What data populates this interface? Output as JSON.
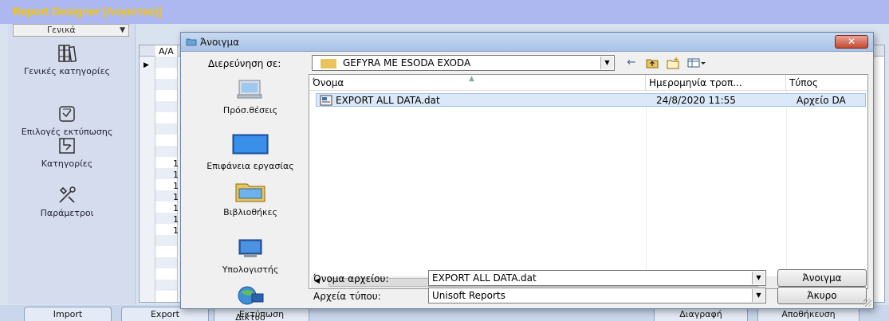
{
  "app": {
    "title": "Report Designer [Λογιστική]",
    "category_select": "Γενικά",
    "sidebar": [
      {
        "label": "Γενικές κατηγορίες",
        "icon": "books-icon"
      },
      {
        "label": "Επιλογές εκτύπωσης",
        "icon": "print-options-icon"
      },
      {
        "label": "Κατηγορίες",
        "icon": "categories-icon"
      },
      {
        "label": "Παράμετροι",
        "icon": "tools-icon"
      }
    ],
    "grid": {
      "column_header": "Α/Α",
      "row_numbers": [
        "1",
        "1",
        "1",
        "1",
        "1",
        "1",
        "1"
      ]
    },
    "bottom_tabs": {
      "import": "Import",
      "export": "Export",
      "print": "Εκτύπωση",
      "delete": "Διαγραφή",
      "save": "Αποθήκευση"
    }
  },
  "dialog": {
    "title": "Άνοιγμα",
    "close_label": "✕",
    "look_in_label": "Διερεύνηση σε:",
    "look_in_value": "GEFYRA ME ESODA EXODA",
    "places": [
      {
        "label": "Πρόσ.θέσεις",
        "icon": "recent-places-icon"
      },
      {
        "label": "Επιφάνεια εργασίας",
        "icon": "desktop-icon"
      },
      {
        "label": "Βιβλιοθήκες",
        "icon": "libraries-icon"
      },
      {
        "label": "Υπολογιστής",
        "icon": "computer-icon"
      },
      {
        "label": "Δίκτυο",
        "icon": "network-icon"
      }
    ],
    "columns": {
      "name": "Όνομα",
      "date": "Ημερομηνία τροπ...",
      "type": "Τύπος"
    },
    "files": [
      {
        "name": "EXPORT ALL DATA.dat",
        "date": "24/8/2020 11:55",
        "type": "Αρχείο DA"
      }
    ],
    "scroll_thumb_label": "III",
    "filename_label": "Όνομα αρχείου:",
    "filename_value": "EXPORT ALL DATA.dat",
    "filetype_label": "Αρχεία τύπου:",
    "filetype_value": "Unisoft Reports",
    "open_button": "Άνοιγμα",
    "cancel_button": "Άκυρο"
  }
}
